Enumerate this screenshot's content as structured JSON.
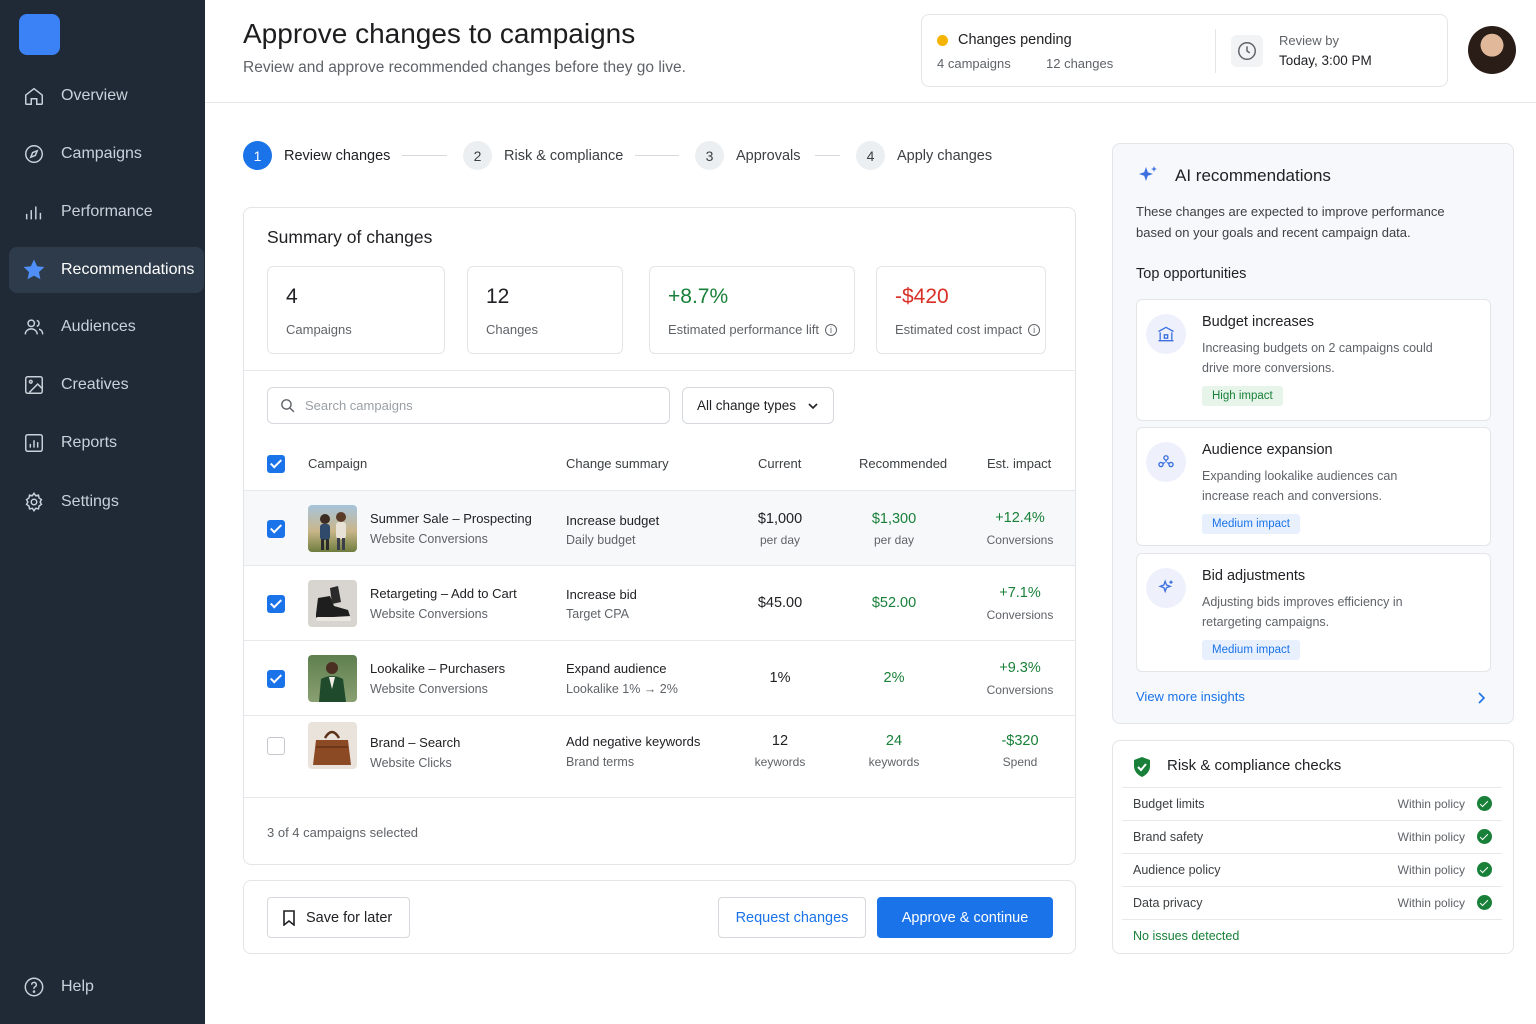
{
  "nav": {
    "items": [
      {
        "label": "Overview",
        "icon": "home-icon"
      },
      {
        "label": "Campaigns",
        "icon": "compass-icon"
      },
      {
        "label": "Performance",
        "icon": "bar-chart-icon"
      },
      {
        "label": "Recommendations",
        "icon": "star-icon",
        "active": true
      },
      {
        "label": "Audiences",
        "icon": "people-icon"
      },
      {
        "label": "Creatives",
        "icon": "image-icon"
      },
      {
        "label": "Reports",
        "icon": "report-icon"
      },
      {
        "label": "Settings",
        "icon": "gear-icon"
      }
    ],
    "help": "Help"
  },
  "header": {
    "title": "Approve changes to campaigns",
    "subtitle": "Review and approve recommended changes before they go live.",
    "pending": {
      "title": "Changes pending",
      "campaigns": "4 campaigns",
      "changes": "12 changes"
    },
    "review": {
      "label": "Review by",
      "value": "Today, 3:00 PM"
    }
  },
  "steps": [
    {
      "num": "1",
      "label": "Review changes"
    },
    {
      "num": "2",
      "label": "Risk & compliance"
    },
    {
      "num": "3",
      "label": "Approvals"
    },
    {
      "num": "4",
      "label": "Apply changes"
    }
  ],
  "summary": {
    "title": "Summary of changes",
    "stats": [
      {
        "value": "4",
        "label": "Campaigns"
      },
      {
        "value": "12",
        "label": "Changes"
      },
      {
        "value": "+8.7%",
        "label": "Estimated performance lift"
      },
      {
        "value": "-$420",
        "label": "Estimated cost impact"
      }
    ],
    "search_placeholder": "Search campaigns",
    "filter": "All change types",
    "columns": [
      "Campaign",
      "Change summary",
      "Current",
      "Recommended",
      "Est. impact"
    ],
    "rows": [
      {
        "checked": true,
        "name": "Summer Sale – Prospecting",
        "sub": "Website Conversions",
        "change": "Increase budget",
        "change_sub": "Daily budget",
        "current": "$1,000",
        "current_sub": "per day",
        "rec": "$1,300",
        "rec_sub": "per day",
        "impact": "+12.4%",
        "impact_sub": "Conversions"
      },
      {
        "checked": true,
        "name": "Retargeting – Add to Cart",
        "sub": "Website Conversions",
        "change": "Increase bid",
        "change_sub": "Target CPA",
        "current": "$45.00",
        "current_sub": "",
        "rec": "$52.00",
        "rec_sub": "",
        "impact": "+7.1%",
        "impact_sub": "Conversions"
      },
      {
        "checked": true,
        "name": "Lookalike – Purchasers",
        "sub": "Website Conversions",
        "change": "Expand audience",
        "change_sub": "Lookalike 1% → 2%",
        "current": "1%",
        "current_sub": "",
        "rec": "2%",
        "rec_sub": "",
        "impact": "+9.3%",
        "impact_sub": "Conversions"
      },
      {
        "checked": false,
        "name": "Brand – Search",
        "sub": "Website Clicks",
        "change": "Add negative keywords",
        "change_sub": "Brand terms",
        "current": "12",
        "current_sub": "keywords",
        "rec": "24",
        "rec_sub": "keywords",
        "impact": "-$320",
        "impact_sub": "Spend"
      }
    ],
    "selected": "3 of 4 campaigns selected"
  },
  "actions": {
    "save": "Save for later",
    "request": "Request changes",
    "approve": "Approve & continue"
  },
  "ai": {
    "title": "AI recommendations",
    "desc1": "These changes are expected to improve performance",
    "desc2": "based on your goals and recent campaign data.",
    "top": "Top opportunities",
    "opps": [
      {
        "title": "Budget increases",
        "desc": "Increasing budgets on 2 campaigns could drive more conversions.",
        "badge": "High impact"
      },
      {
        "title": "Audience expansion",
        "desc": "Expanding lookalike audiences can increase reach and conversions.",
        "badge": "Medium impact"
      },
      {
        "title": "Bid adjustments",
        "desc": "Adjusting bids improves efficiency in retargeting campaigns.",
        "badge": "Medium impact"
      }
    ],
    "more": "View more insights"
  },
  "risk": {
    "title": "Risk & compliance checks",
    "checks": [
      {
        "name": "Budget limits",
        "status": "Within policy"
      },
      {
        "name": "Brand safety",
        "status": "Within policy"
      },
      {
        "name": "Audience policy",
        "status": "Within policy"
      },
      {
        "name": "Data privacy",
        "status": "Within policy"
      }
    ],
    "footer": "No issues detected"
  },
  "colors": {
    "accent": "#1a73e8",
    "positive": "#188038",
    "negative": "#d93025",
    "sidebar": "#1f2a36"
  }
}
